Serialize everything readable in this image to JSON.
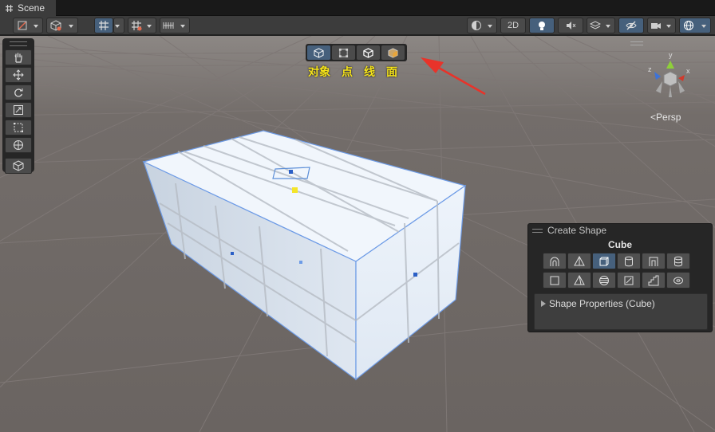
{
  "window": {
    "tab_title": "Scene"
  },
  "toolbar": {
    "toggle_2d_label": "2D"
  },
  "tool_strip": {
    "tools": [
      "hand-icon",
      "move-icon",
      "rotate-icon",
      "scale-icon",
      "rect-icon",
      "transform-icon",
      "custom-tool-icon"
    ]
  },
  "probuilder": {
    "mode_labels": [
      "对象",
      "点",
      "线",
      "面"
    ],
    "active_mode": 0
  },
  "gizmo": {
    "axis_x": "x",
    "axis_y": "y",
    "axis_z": "z",
    "projection_label": "Persp"
  },
  "create_shape": {
    "title": "Create Shape",
    "selected_shape": "Cube",
    "properties_label": "Shape Properties (Cube)",
    "active_index": 2
  },
  "colors": {
    "accent": "#46607c",
    "annotation_text": "#f6e41a",
    "annotation_arrow": "#e8332a",
    "scene_background": "#6f6865"
  }
}
